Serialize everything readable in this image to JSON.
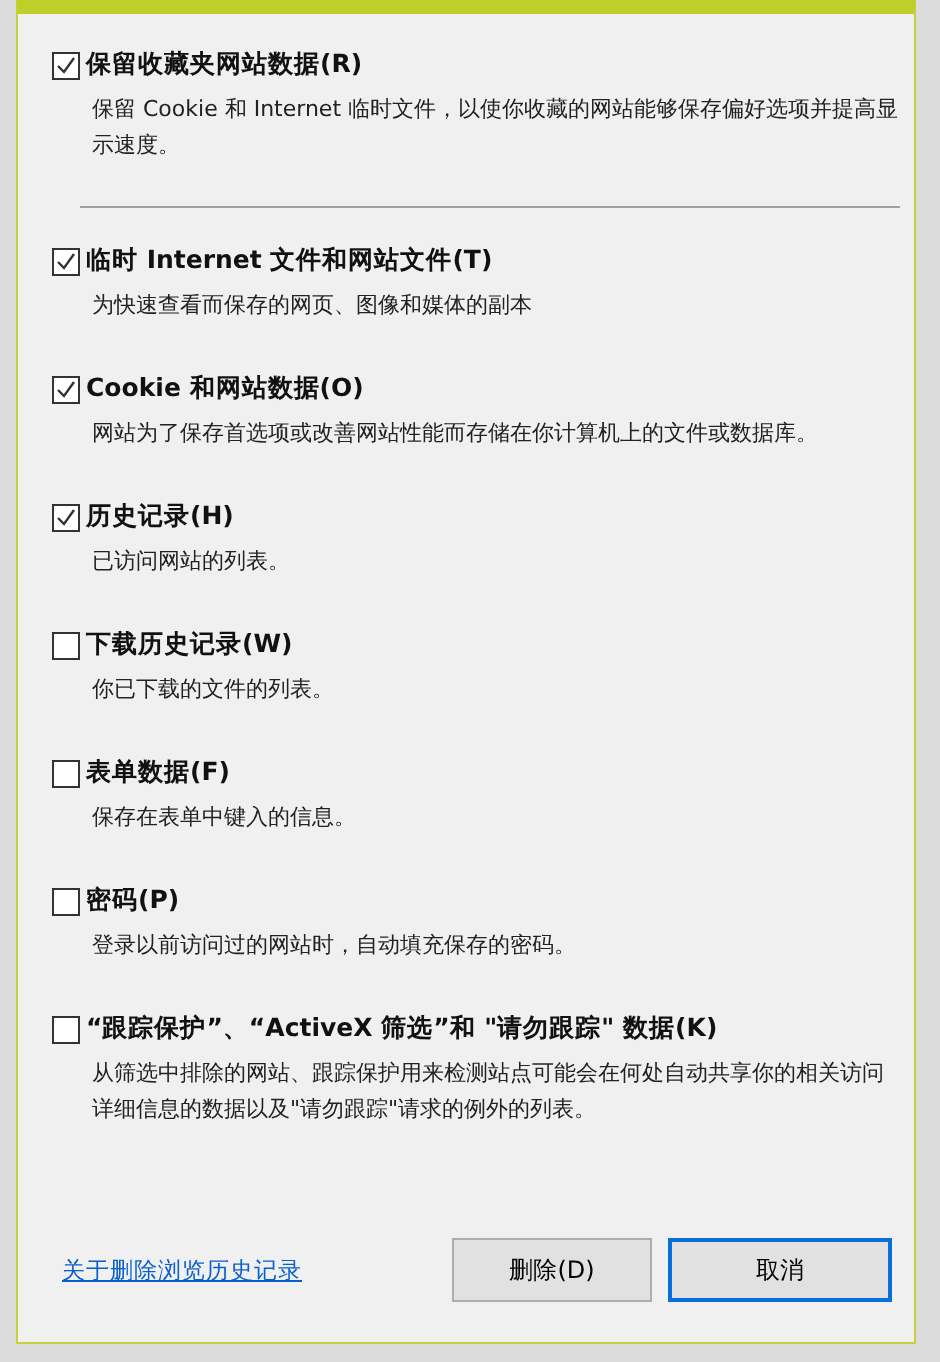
{
  "options": [
    {
      "label": "保留收藏夹网站数据(R)",
      "description": "保留 Cookie 和 Internet 临时文件，以使你收藏的网站能够保存偏好选项并提高显示速度。",
      "checked": true
    },
    {
      "label": "临时 Internet 文件和网站文件(T)",
      "description": "为快速查看而保存的网页、图像和媒体的副本",
      "checked": true
    },
    {
      "label": "Cookie 和网站数据(O)",
      "description": "网站为了保存首选项或改善网站性能而存储在你计算机上的文件或数据库。",
      "checked": true
    },
    {
      "label": "历史记录(H)",
      "description": "已访问网站的列表。",
      "checked": true
    },
    {
      "label": "下载历史记录(W)",
      "description": "你已下载的文件的列表。",
      "checked": false
    },
    {
      "label": "表单数据(F)",
      "description": "保存在表单中键入的信息。",
      "checked": false
    },
    {
      "label": "密码(P)",
      "description": "登录以前访问过的网站时，自动填充保存的密码。",
      "checked": false
    },
    {
      "label": "“跟踪保护”、“ActiveX 筛选”和 \"请勿跟踪\" 数据(K)",
      "description": "从筛选中排除的网站、跟踪保护用来检测站点可能会在何处自动共享你的相关访问详细信息的数据以及\"请勿跟踪\"请求的例外的列表。",
      "checked": false
    }
  ],
  "link": "关于删除浏览历史记录",
  "buttons": [
    {
      "label": "删除(D)",
      "default": false
    },
    {
      "label": "取消",
      "default": true
    }
  ]
}
